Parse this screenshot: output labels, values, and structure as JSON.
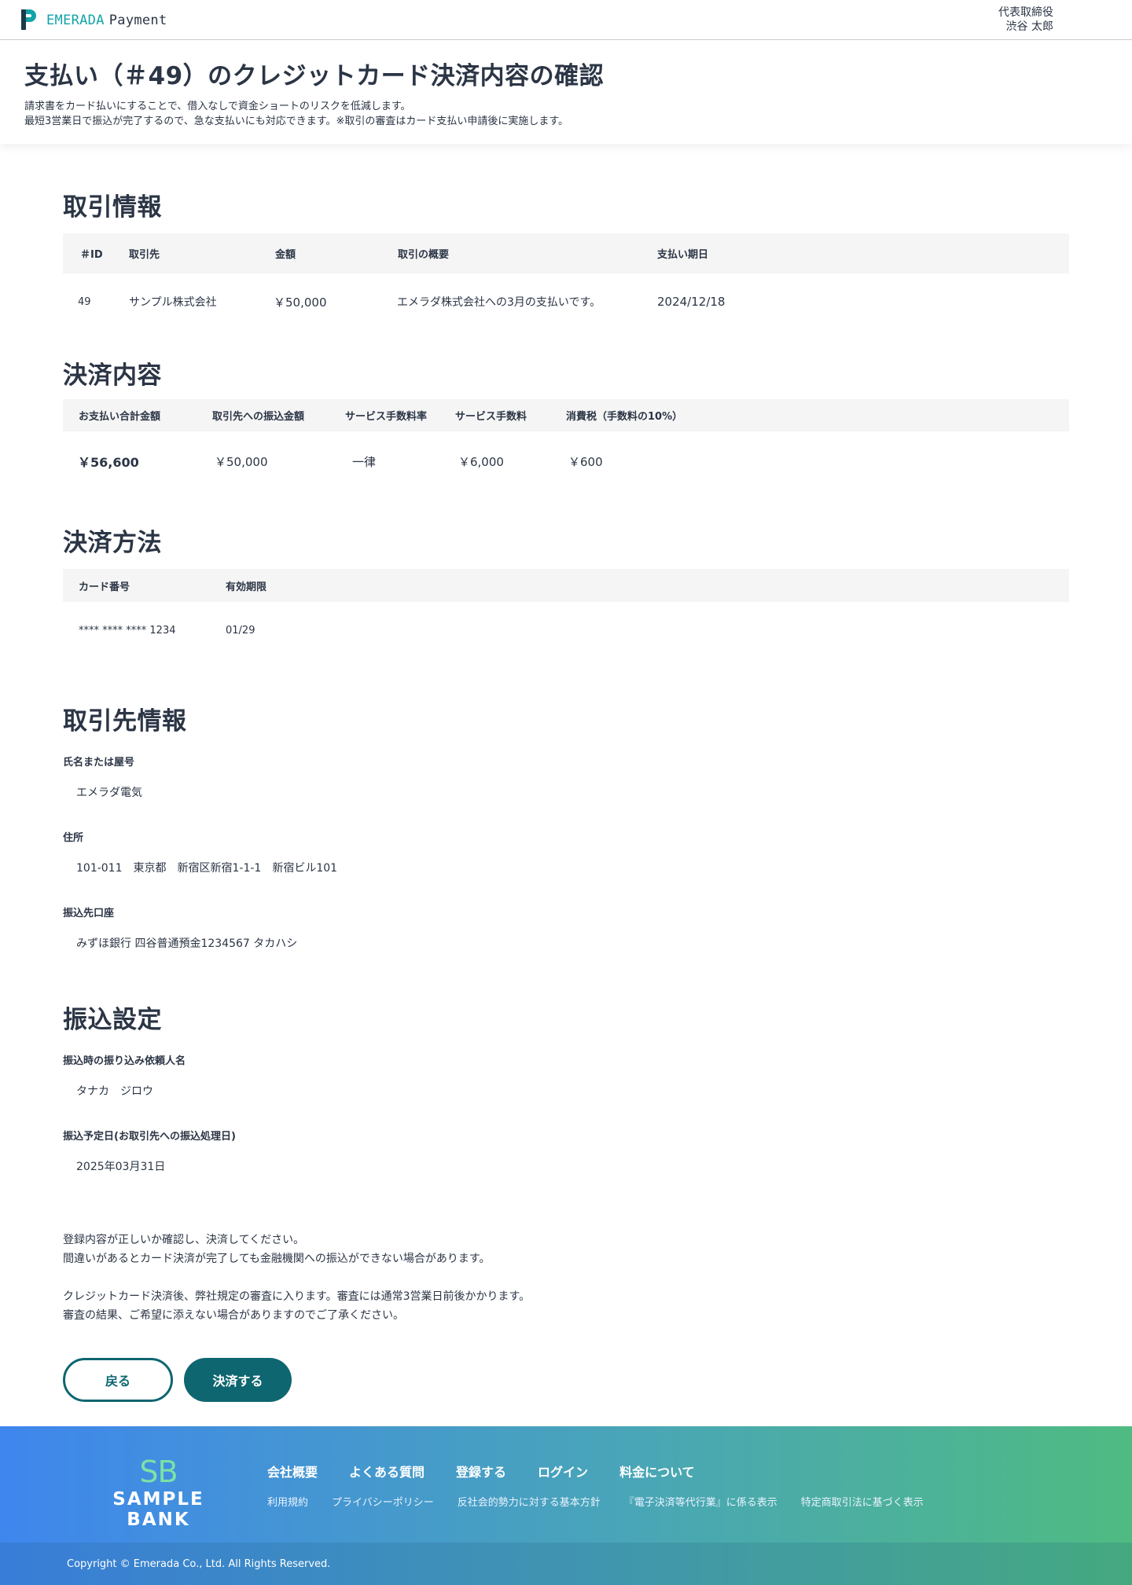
{
  "header": {
    "brand": "EMERADA",
    "product": "Payment",
    "user_role": "代表取締役",
    "user_name": "渋谷 太郎"
  },
  "page": {
    "title": "支払い（＃49）のクレジットカード決済内容の確認",
    "desc_line1": "請求書をカード払いにすることで、借入なしで資金ショートのリスクを低減します。",
    "desc_line2": "最短3営業日で振込が完了するので、急な支払いにも対応できます。※取引の審査はカード支払い申請後に実施します。"
  },
  "transaction": {
    "title": "取引情報",
    "headers": [
      "＃ID",
      "取引先",
      "金額",
      "取引の概要",
      "支払い期日"
    ],
    "row": [
      "49",
      "サンプル株式会社",
      "￥50,000",
      "エメラダ株式会社への3月の支払いです。",
      "2024/12/18"
    ]
  },
  "payment": {
    "title": "決済内容",
    "headers": [
      "お支払い合計金額",
      "取引先への振込金額",
      "サービス手数料率",
      "サービス手数料",
      "消費税（手数料の10%）"
    ],
    "row": [
      "￥56,600",
      "￥50,000",
      "一律",
      "￥6,000",
      "￥600"
    ]
  },
  "method": {
    "title": "決済方法",
    "headers": [
      "カード番号",
      "有効期限"
    ],
    "row": [
      "**** **** **** 1234",
      "01/29"
    ]
  },
  "partner": {
    "title": "取引先情報",
    "name_label": "氏名または屋号",
    "name_value": "エメラダ電気",
    "address_label": "住所",
    "address_value": "101-011　東京都　新宿区新宿1-1-1　新宿ビル101",
    "account_label": "振込先口座",
    "account_value": "みずほ銀行 四谷普通預金1234567 タカハシ"
  },
  "transfer": {
    "title": "振込設定",
    "requester_label": "振込時の振り込み依頼人名",
    "requester_value": "タナカ　ジロウ",
    "date_label": "振込予定日(お取引先への振込処理日)",
    "date_value": "2025年03月31日"
  },
  "notes": {
    "line1": "登録内容が正しいか確認し、決済してください。",
    "line2": "間違いがあるとカード決済が完了しても金融機関への振込ができない場合があります。",
    "line3": "クレジットカード決済後、弊社規定の審査に入ります。審査には通常3営業日前後かかります。",
    "line4": "審査の結果、ご希望に添えない場合がありますのでご了承ください。"
  },
  "actions": {
    "back_label": "戻る",
    "pay_label": "決済する"
  },
  "footer": {
    "logo_mark": "SB",
    "logo_name": "SAMPLE BANK",
    "nav_main": [
      "会社概要",
      "よくある質問",
      "登録する",
      "ログイン",
      "料金について"
    ],
    "nav_sub": [
      "利用規約",
      "プライバシーポリシー",
      "反社会的勢力に対する基本方針",
      "『電子決済等代行業』に係る表示",
      "特定商取引法に基づく表示"
    ],
    "copyright": "Copyright © Emerada Co., Ltd. All Rights Reserved."
  },
  "colors": {
    "brand_teal": "#12a3a8",
    "button_teal": "#0e6670",
    "text_dark": "#2b3545",
    "footer_gradient_start": "#3f86ee",
    "footer_gradient_end": "#4fbb82"
  },
  "icons": {
    "logo": "emerada-p-logo-icon"
  }
}
